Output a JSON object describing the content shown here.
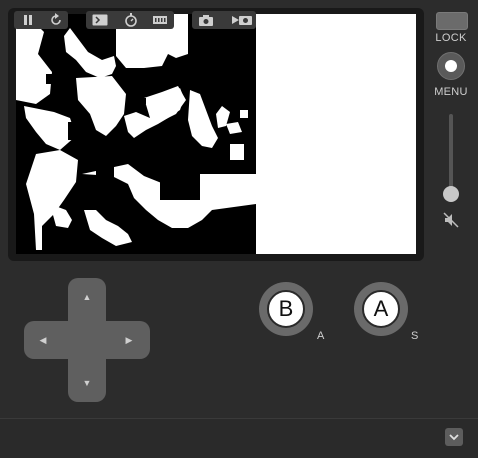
{
  "side": {
    "lock_label": "LOCK",
    "menu_label": "MENU",
    "volume_level": 0.1
  },
  "buttons": {
    "b_label": "B",
    "a_label": "A",
    "b_key_hint": "A",
    "a_key_hint": "S"
  },
  "dpad": {
    "up": "▲",
    "down": "▼",
    "left": "◀",
    "right": "▶"
  },
  "colors": {
    "body": "#2c2c2c",
    "bezel": "#191919",
    "screen_white": "#ffffff",
    "screen_black": "#000000",
    "control_gray": "#5f5f5f"
  },
  "icons": {
    "toolbar": [
      "pause-icon",
      "restart-icon",
      "console-icon",
      "stopwatch-icon",
      "memory-chip-icon",
      "screenshot-icon",
      "record-video-icon",
      "chevron-down-icon"
    ],
    "side": [
      "lock-button",
      "menu-button",
      "mute-icon"
    ]
  }
}
